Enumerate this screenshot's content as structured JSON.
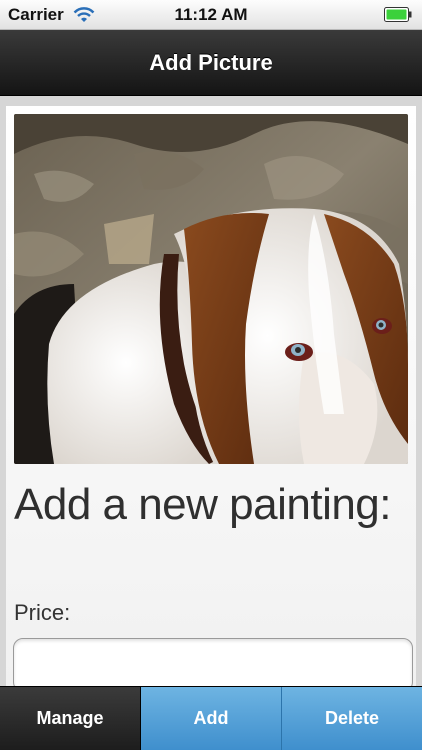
{
  "status_bar": {
    "carrier": "Carrier",
    "time": "11:12 AM",
    "wifi_icon": "wifi-icon",
    "battery_icon": "battery-icon",
    "battery_color": "#3bd13b"
  },
  "nav": {
    "title": "Add Picture"
  },
  "main": {
    "photo_description_icon": "basset-hound-photo",
    "heading": "Add a new painting:",
    "price_label": "Price:",
    "price_value": "",
    "price_placeholder": ""
  },
  "tab_bar": {
    "manage_label": "Manage",
    "add_label": "Add",
    "delete_label": "Delete",
    "active_color": "#4a9ad6"
  }
}
